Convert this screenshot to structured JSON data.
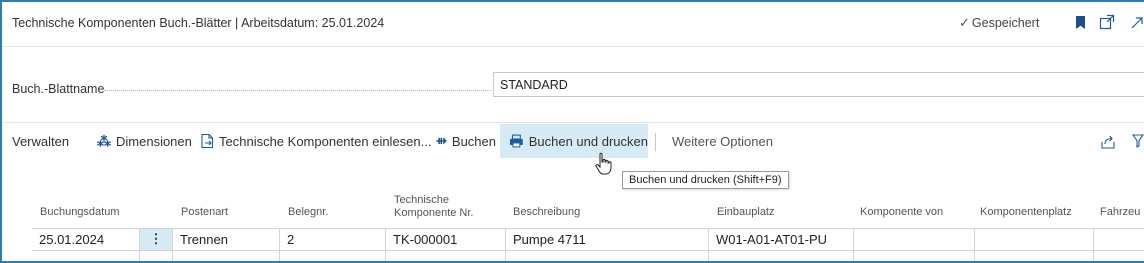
{
  "header": {
    "title": "Technische Komponenten Buch.-Blätter | Arbeitsdatum: 25.01.2024",
    "saved_label": "Gespeichert"
  },
  "journal": {
    "label": "Buch.-Blattname",
    "value": "STANDARD"
  },
  "actions": {
    "verwalten": "Verwalten",
    "dimensionen": "Dimensionen",
    "import": "Technische Komponenten einlesen...",
    "buchen": "Buchen",
    "buchen_drucken": "Buchen und drucken",
    "weitere": "Weitere Optionen"
  },
  "tooltip": "Buchen und drucken (Shift+F9)",
  "columns": {
    "buchungsdatum": "Buchungsdatum",
    "postenart": "Postenart",
    "belegnr": "Belegnr.",
    "tech_line1": "Technische",
    "tech_line2": "Komponente Nr.",
    "beschreibung": "Beschreibung",
    "einbauplatz": "Einbauplatz",
    "komponente_von": "Komponente von",
    "komponentenplatz": "Komponentenplatz",
    "fahrzeug": "Fahrzeu"
  },
  "rows": [
    {
      "buchungsdatum": "25.01.2024",
      "menu": "⋮",
      "postenart": "Trennen",
      "belegnr": "2",
      "tech_nr": "TK-000001",
      "beschreibung": "Pumpe 4711",
      "einbauplatz": "W01-A01-AT01-PU",
      "komponente_von": "",
      "komponentenplatz": "",
      "fahrzeug": ""
    }
  ],
  "colors": {
    "frame": "#2b7bbd",
    "highlight": "#d6ebf5",
    "icon_blue": "#1f5a9c",
    "bookmark": "#1f4e8c"
  },
  "icons": [
    "check-icon",
    "bookmark-icon",
    "popout-icon",
    "collapse-icon",
    "dimensions-icon",
    "import-icon",
    "post-icon",
    "print-icon",
    "share-icon",
    "filter-icon",
    "hand-cursor-icon",
    "kebab-menu-icon"
  ]
}
